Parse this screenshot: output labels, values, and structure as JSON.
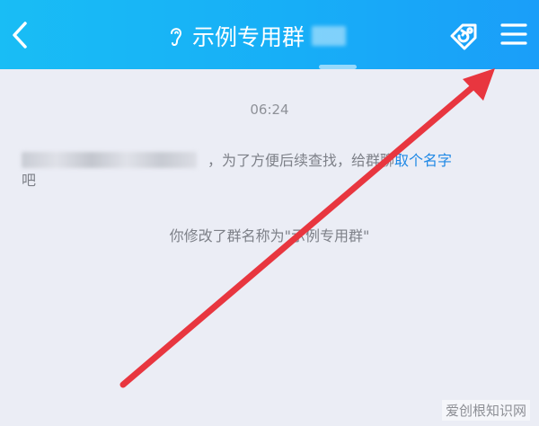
{
  "header": {
    "title": "示例专用群",
    "back_icon": "chevron-left-icon",
    "voice_icon": "ear-icon",
    "tag_icon": "tag-sync-icon",
    "menu_icon": "menu-icon",
    "bg_color": "#17aef7"
  },
  "chat": {
    "time": "06:24",
    "system_message_1": {
      "text": "，为了方便后续查找，给群聊",
      "link": "取个名字",
      "text_end": "吧"
    },
    "system_message_2": "你修改了群名称为\"示例专用群\""
  },
  "annotation": {
    "arrow_color": "#e8363f"
  },
  "watermark": "爱创根知识网"
}
